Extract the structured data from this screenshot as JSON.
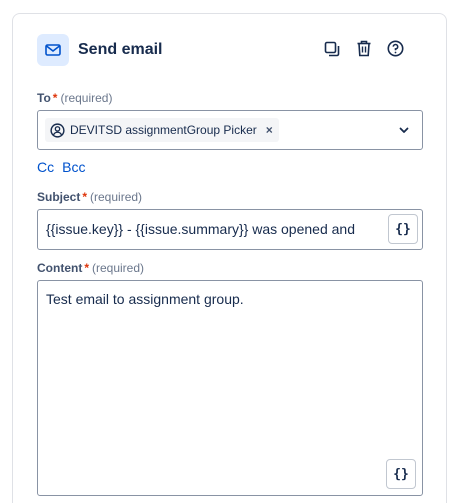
{
  "header": {
    "title": "Send email",
    "icon": "mail-icon",
    "accent_color": "#0052cc",
    "actions": [
      "duplicate-icon",
      "trash-icon",
      "help-icon"
    ]
  },
  "to": {
    "label": "To",
    "required_mark": "*",
    "hint": "(required)",
    "chip_label": "DEVITSD assignmentGroup Picker",
    "chip_remove": "×"
  },
  "cc_label": "Cc",
  "bcc_label": "Bcc",
  "subject": {
    "label": "Subject",
    "required_mark": "*",
    "hint": "(required)",
    "value": "{{issue.key}} - {{issue.summary}} was opened and",
    "smart_value_button": "{}"
  },
  "content": {
    "label": "Content",
    "required_mark": "*",
    "hint": "(required)",
    "value": "Test email to assignment group.",
    "smart_value_button": "{}"
  }
}
